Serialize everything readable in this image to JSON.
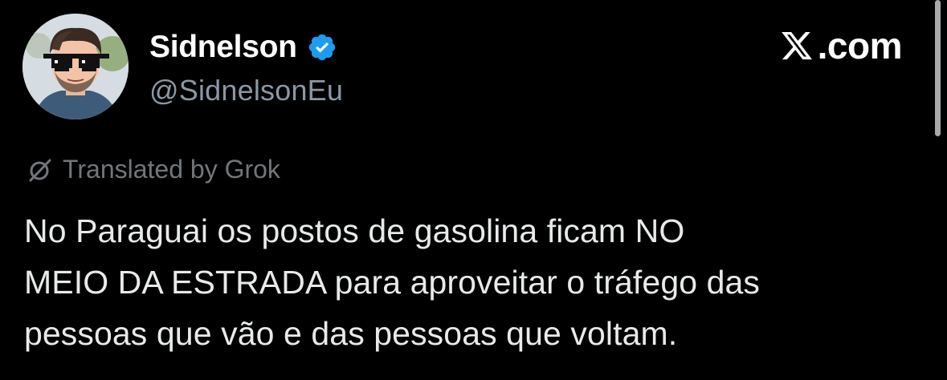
{
  "author": {
    "display_name": "Sidnelson",
    "handle": "@SidnelsonEu",
    "verified": true,
    "avatar": "avatar-cartoon-sunglasses"
  },
  "brand": {
    "logo": "x-logo-icon",
    "suffix": ".com"
  },
  "translation": {
    "icon": "grok-icon",
    "label": "Translated by Grok"
  },
  "tweet": {
    "text": "No Paraguai os postos de gasolina ficam NO\nMEIO DA ESTRADA para aproveitar o tráfego das\npessoas que vão e das pessoas que voltam."
  },
  "colors": {
    "background": "#000000",
    "text": "#e7e9ea",
    "muted": "#71767b",
    "verified": "#1d9bf0"
  }
}
